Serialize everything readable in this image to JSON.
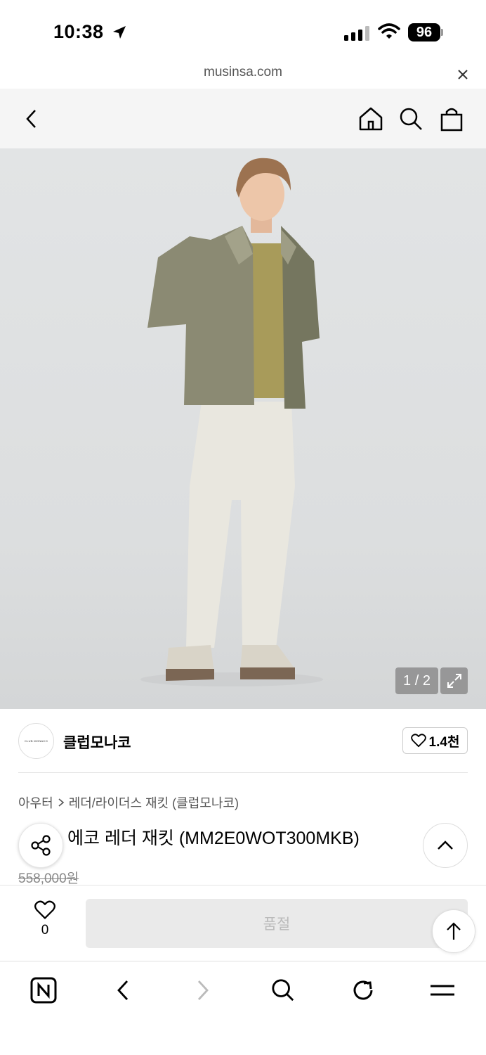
{
  "status_bar": {
    "time": "10:38",
    "battery": "96"
  },
  "url_bar": {
    "domain": "musinsa.com"
  },
  "header": {
    "back_icon": "chevron-left-icon",
    "home_icon": "home-icon",
    "search_icon": "search-icon",
    "cart_icon": "shopping-bag-icon"
  },
  "image": {
    "counter": "1 / 2"
  },
  "brand": {
    "name": "클럽모나코",
    "logo_text": "CLUB MONACO",
    "likes": "1.4천"
  },
  "product": {
    "breadcrumb": [
      "아우터",
      "레더/라이더스 재킷 (클럽모나코)"
    ],
    "title": "에코 레더 재킷 (MM2E0WOT300MKB)",
    "original_price": "558,000원"
  },
  "purchase": {
    "wish_count": "0",
    "soldout_label": "품절"
  },
  "colors": {
    "header_bg": "#f5f5f5",
    "soldout_bg": "#eaeaea",
    "soldout_text": "#bbbbbb"
  }
}
